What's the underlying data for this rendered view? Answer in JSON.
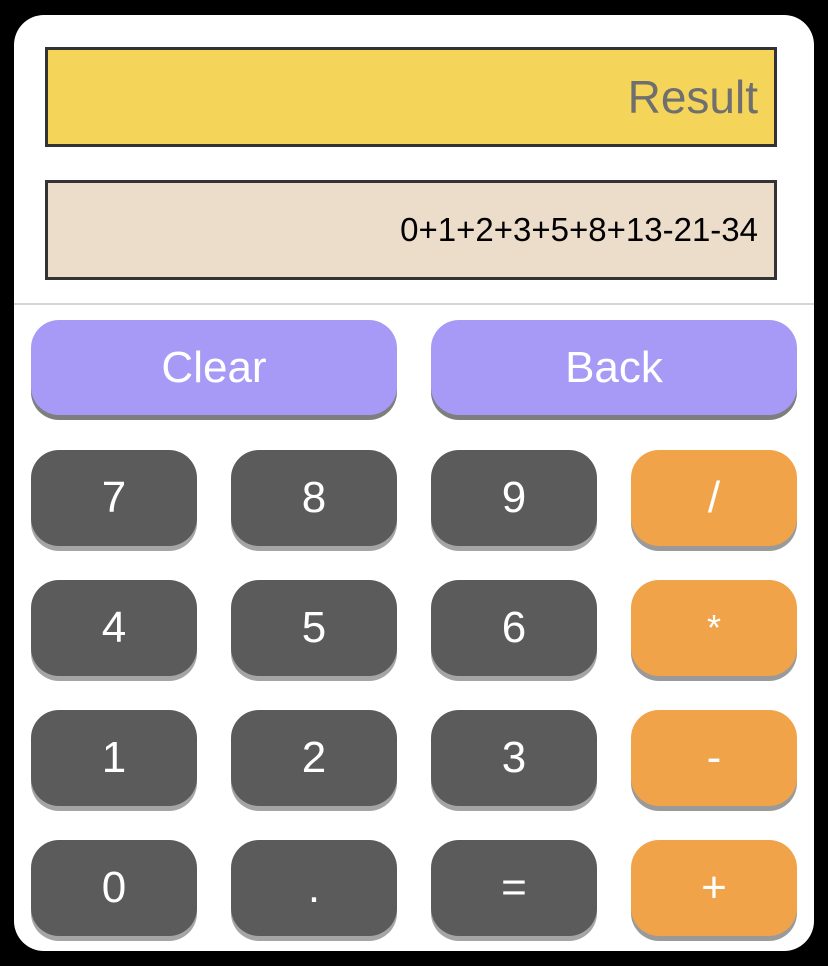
{
  "display": {
    "result_placeholder": "Result",
    "expression": "0+1+2+3+5+8+13-21-34"
  },
  "controls": {
    "clear": "Clear",
    "back": "Back"
  },
  "keys": {
    "seven": "7",
    "eight": "8",
    "nine": "9",
    "divide": "/",
    "four": "4",
    "five": "5",
    "six": "6",
    "multiply": "*",
    "one": "1",
    "two": "2",
    "three": "3",
    "subtract": "-",
    "zero": "0",
    "decimal": ".",
    "equals": "=",
    "add": "+"
  },
  "colors": {
    "result_bg": "#f4d55a",
    "expression_bg": "#ecdcca",
    "control_button": "#a79af6",
    "number_button": "#5b5b5b",
    "operator_button": "#f0a349"
  }
}
